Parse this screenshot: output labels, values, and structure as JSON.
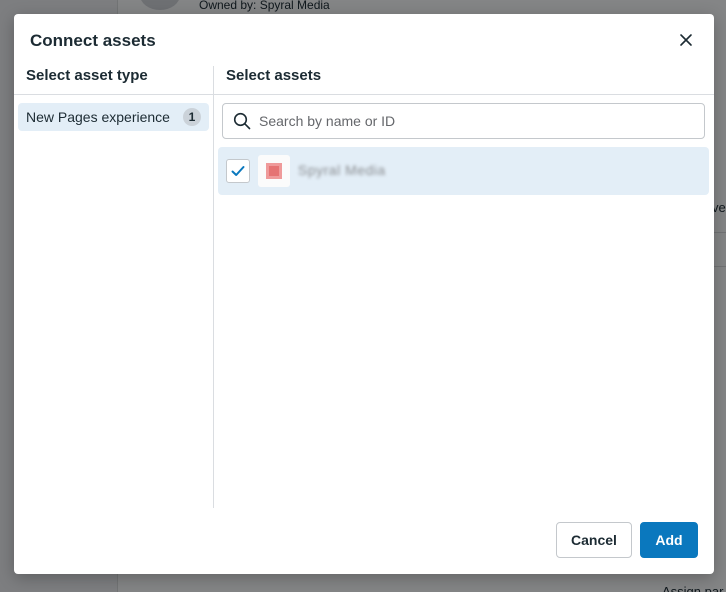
{
  "background": {
    "owned_by": "Owned by: Spyral Media",
    "right_fragment": "ve",
    "bottom_fragment": "Assign par"
  },
  "dialog": {
    "title": "Connect assets",
    "close_icon": "close-icon",
    "left_column": {
      "header": "Select asset type",
      "items": [
        {
          "label": "New Pages experience",
          "count": "1",
          "selected": true
        }
      ]
    },
    "right_column": {
      "header": "Select assets",
      "search": {
        "placeholder": "Search by name or ID",
        "value": "",
        "icon": "search-icon"
      },
      "assets": [
        {
          "name": "Spyral Media",
          "checked": true,
          "thumbnail": "page-thumbnail"
        }
      ]
    },
    "footer": {
      "cancel_label": "Cancel",
      "add_label": "Add"
    }
  },
  "colors": {
    "accent": "#0a78be",
    "selected_bg": "#e3eef7",
    "text": "#1c2b33",
    "border": "#c4c8cc"
  }
}
